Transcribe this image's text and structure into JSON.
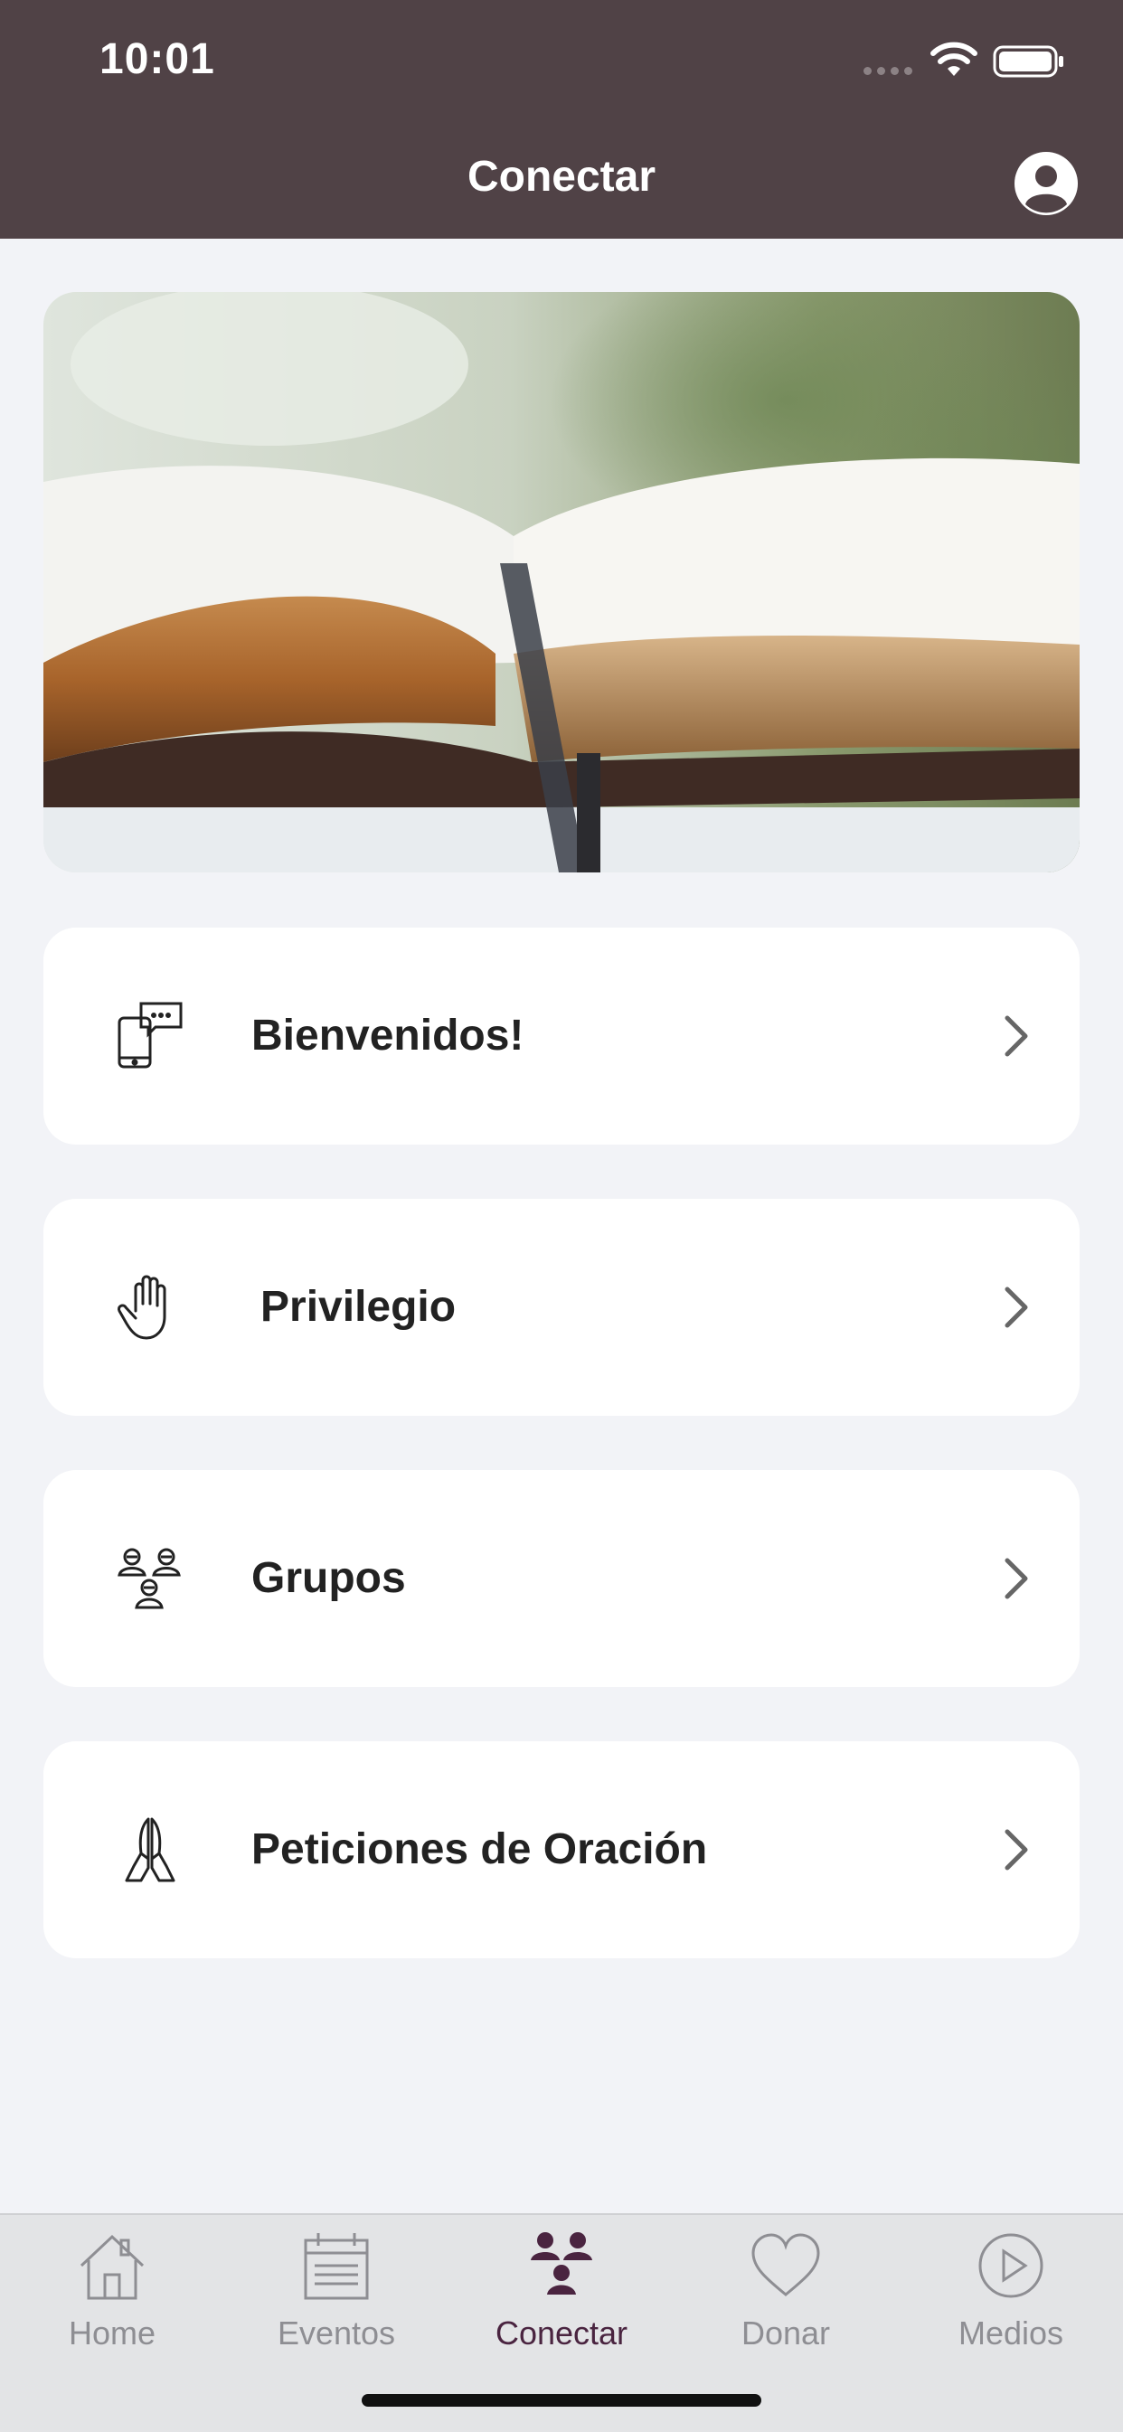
{
  "status_bar": {
    "time": "10:01"
  },
  "header": {
    "title": "Conectar",
    "profile_icon": "person-circle-icon"
  },
  "colors": {
    "header_bg": "#504246",
    "page_bg": "#f2f3f7",
    "active_tab": "#4a2440",
    "inactive_tab": "#8e8e93"
  },
  "hero": {
    "image": "open-bible-photo"
  },
  "menu": [
    {
      "label": "Bienvenidos!",
      "icon": "phone-chat-icon"
    },
    {
      "label": "Privilegio",
      "icon": "raised-hand-icon"
    },
    {
      "label": "Grupos",
      "icon": "people-group-icon"
    },
    {
      "label": "Peticiones de Oración",
      "icon": "praying-hands-icon"
    }
  ],
  "tabbar": {
    "active": "Conectar",
    "tabs": [
      {
        "label": "Home",
        "icon": "house-icon"
      },
      {
        "label": "Eventos",
        "icon": "calendar-icon"
      },
      {
        "label": "Conectar",
        "icon": "people-group-icon"
      },
      {
        "label": "Donar",
        "icon": "heart-icon"
      },
      {
        "label": "Medios",
        "icon": "play-circle-icon"
      }
    ]
  }
}
